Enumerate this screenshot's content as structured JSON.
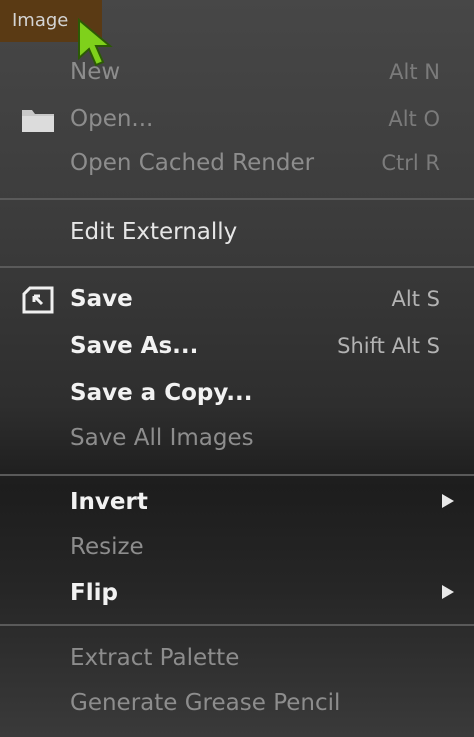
{
  "menu_title": "Image",
  "items": {
    "new": {
      "label": "New",
      "shortcut": "Alt N"
    },
    "open": {
      "label": "Open...",
      "shortcut": "Alt O"
    },
    "open_cached": {
      "label": "Open Cached Render",
      "shortcut": "Ctrl R"
    },
    "edit_externally": {
      "label": "Edit Externally"
    },
    "save": {
      "label": "Save",
      "shortcut": "Alt S"
    },
    "save_as": {
      "label": "Save As...",
      "shortcut": "Shift Alt S"
    },
    "save_copy": {
      "label": "Save a Copy..."
    },
    "save_all": {
      "label": "Save All Images"
    },
    "invert": {
      "label": "Invert"
    },
    "resize": {
      "label": "Resize"
    },
    "flip": {
      "label": "Flip"
    },
    "extract_palette": {
      "label": "Extract Palette"
    },
    "generate_grease_pencil": {
      "label": "Generate Grease Pencil"
    }
  },
  "icons": {
    "open": "folder-icon",
    "save": "save-icon",
    "cursor": "cursor-icon",
    "submenu": "chevron-right-icon"
  },
  "colors": {
    "menu_tab": "#5a3a14",
    "cursor": "#7fd11b"
  }
}
